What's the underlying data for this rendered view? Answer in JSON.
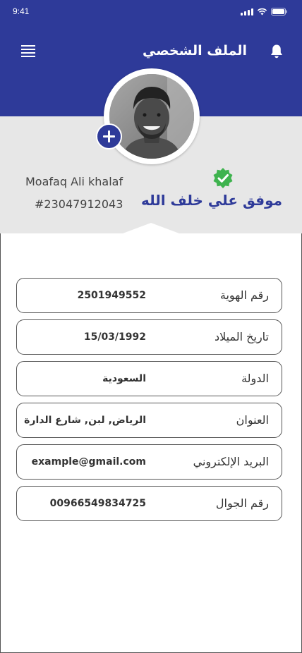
{
  "status_bar": {
    "time": "9:41"
  },
  "header": {
    "title": "الملف الشخصي"
  },
  "profile": {
    "name_ar": "موفق علي خلف الله",
    "name_en": "Moafaq Ali khalaf",
    "user_id": "#23047912043"
  },
  "fields": [
    {
      "label": "رقم الهوية",
      "value": "2501949552"
    },
    {
      "label": "تاريخ الميلاد",
      "value": "15/03/1992"
    },
    {
      "label": "الدولة",
      "value": "السعودية"
    },
    {
      "label": "العنوان",
      "value": "الرياض, لبن, شارع الدارة"
    },
    {
      "label": "البريد الإلكتروني",
      "value": "example@gmail.com"
    },
    {
      "label": "رقم الجوال",
      "value": "00966549834725"
    }
  ],
  "colors": {
    "primary": "#2e3a99",
    "verified": "#3fb34f",
    "band": "#e7e7e7"
  },
  "icons": {
    "menu": "hamburger-menu-icon",
    "notifications": "bell-icon",
    "add_photo": "plus-icon",
    "verified": "verified-badge-icon"
  }
}
